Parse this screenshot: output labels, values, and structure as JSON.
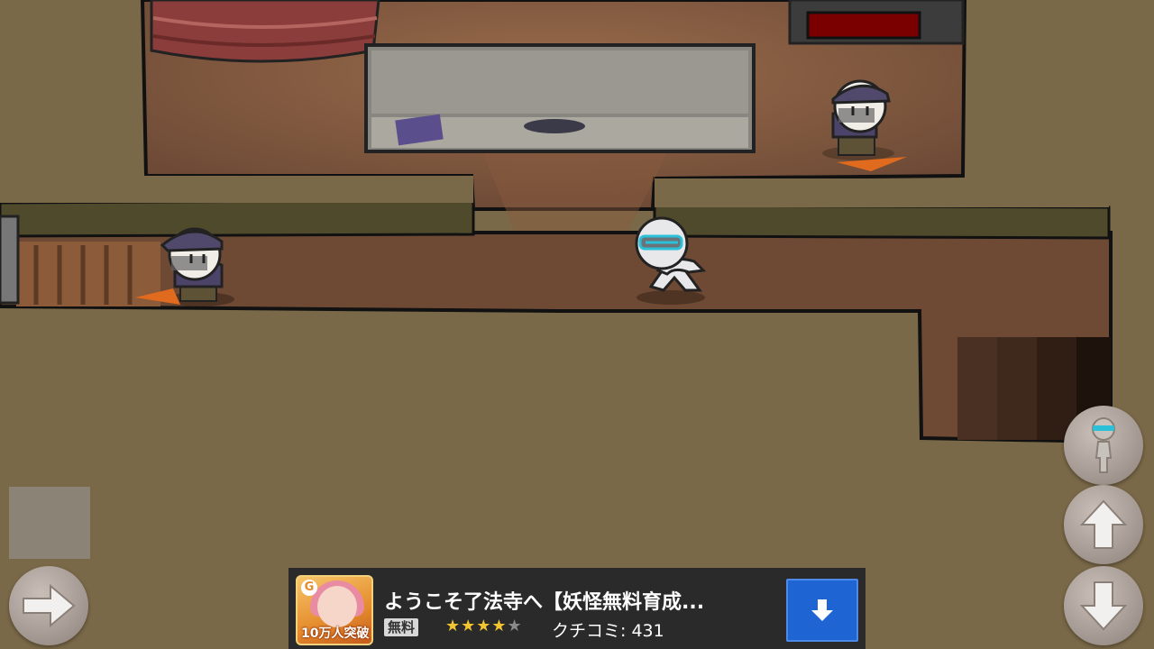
{
  "ad": {
    "title": "ようこそ了法寺へ【妖怪無料育成...",
    "free_label": "無料",
    "rating": 4.5,
    "stars_filled": "★★★★",
    "stars_half": "★",
    "reviews_text": "クチコミ: 431",
    "badge_text": "10万人突破",
    "brand_letter": "G"
  },
  "controls": {
    "right": "right-arrow-icon",
    "up": "up-arrow-icon",
    "down": "down-arrow-icon",
    "disguise": "stickman-icon",
    "download": "download-arrow-icon"
  },
  "colors": {
    "wall": "#7a6948",
    "floor": "#6e4a35",
    "guard_cap": "#51496b",
    "player": "#e8e8ea",
    "visor": "#29c0d8",
    "ad_button": "#1e64d2"
  }
}
